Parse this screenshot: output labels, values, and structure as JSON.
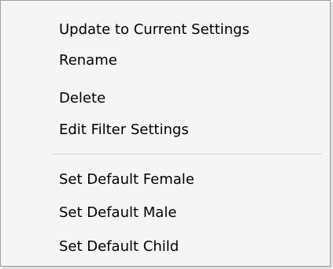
{
  "context_menu": {
    "items": [
      {
        "label": "Update to Current Settings"
      },
      {
        "label": "Rename"
      },
      {
        "label": "Delete"
      },
      {
        "label": "Edit Filter Settings"
      },
      {
        "label": "Set Default Female"
      },
      {
        "label": "Set Default Male"
      },
      {
        "label": "Set Default Child"
      }
    ]
  }
}
